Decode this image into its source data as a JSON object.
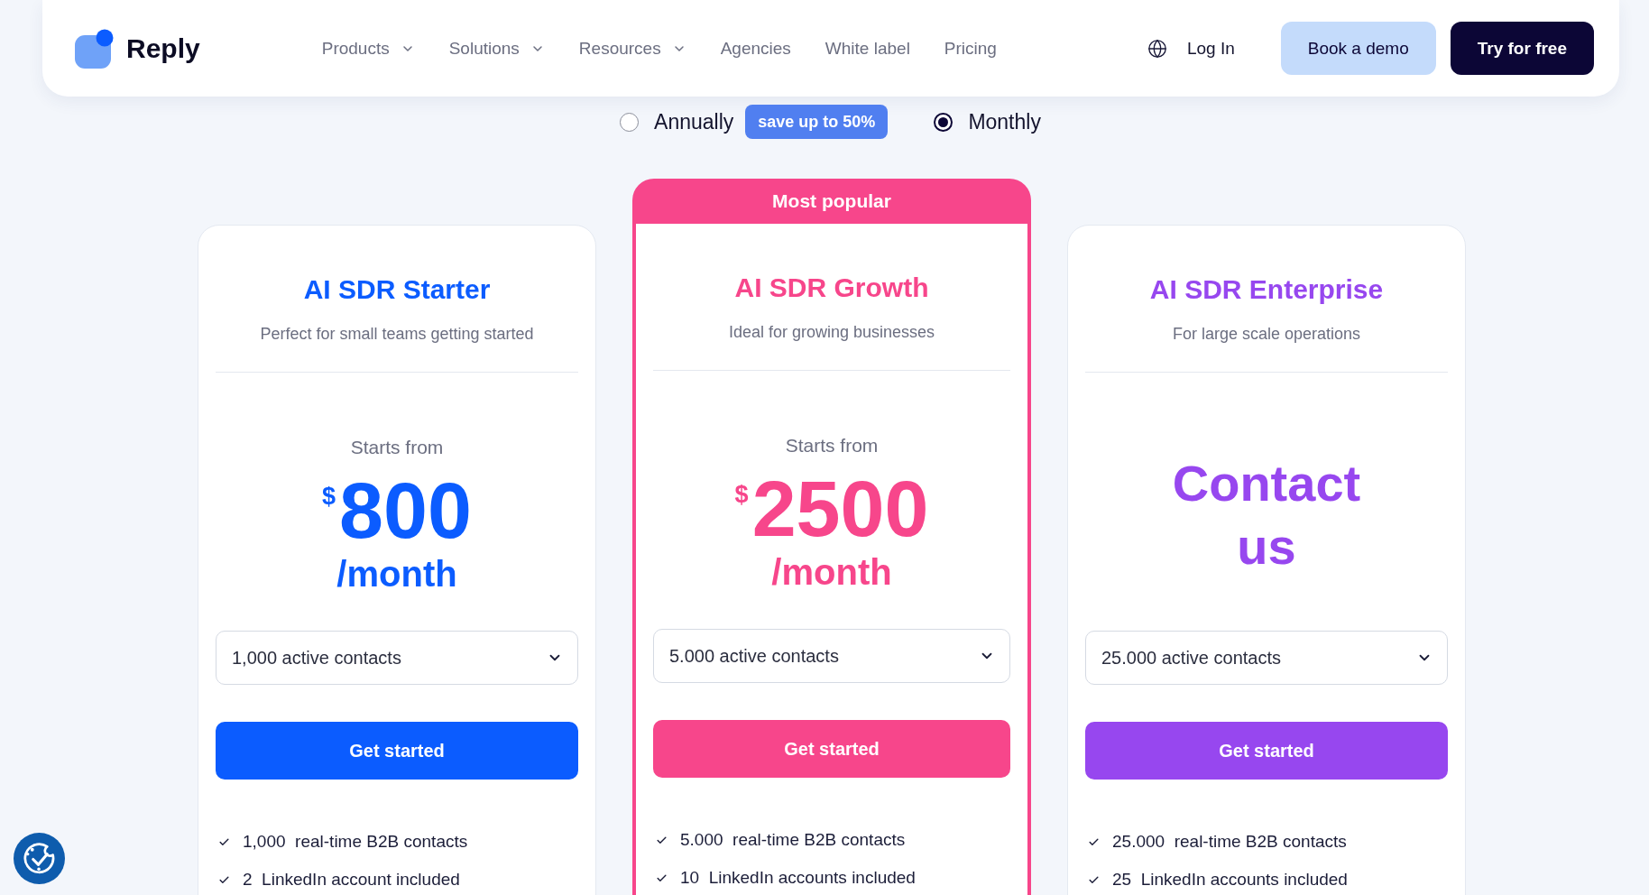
{
  "navbar": {
    "logo": {
      "text": "Reply"
    },
    "links": [
      {
        "label": "Products",
        "has_menu": true
      },
      {
        "label": "Solutions",
        "has_menu": true
      },
      {
        "label": "Resources",
        "has_menu": true
      },
      {
        "label": "Agencies",
        "has_menu": false
      },
      {
        "label": "White label",
        "has_menu": false
      },
      {
        "label": "Pricing",
        "has_menu": false
      }
    ],
    "login": "Log In",
    "buttons": [
      {
        "label": "Book a demo",
        "kind": "secondary"
      },
      {
        "label": "Try for free",
        "kind": "primary"
      }
    ]
  },
  "billing_toggle": {
    "options": [
      {
        "label": "Annually",
        "selected": false,
        "badge": "save up to 50%"
      },
      {
        "label": "Monthly",
        "selected": true
      }
    ]
  },
  "plans": [
    {
      "name": "AI SDR Starter",
      "tagline": "Perfect for small teams getting started",
      "color": "#0b5cff",
      "price": {
        "kind": "amount",
        "label": "Starts from",
        "currency": "$",
        "amount": "800",
        "period": "/month"
      },
      "contacts_select": {
        "value": "1,000 active contacts"
      },
      "cta": "Get started",
      "features": [
        "1,000  real-time B2B contacts",
        "2  LinkedIn account included"
      ]
    },
    {
      "name": "AI SDR Growth",
      "tagline": "Ideal for growing businesses",
      "color": "#f7468b",
      "badge": "Most popular",
      "price": {
        "kind": "amount",
        "label": "Starts from",
        "currency": "$",
        "amount": "2500",
        "period": "/month"
      },
      "contacts_select": {
        "value": "5.000 active contacts"
      },
      "cta": "Get started",
      "features": [
        "5.000  real-time B2B contacts",
        "10  LinkedIn accounts included"
      ]
    },
    {
      "name": "AI SDR Enterprise",
      "tagline": "For large scale operations",
      "color": "#9747ef",
      "price": {
        "kind": "contact",
        "text": "Contact us"
      },
      "contacts_select": {
        "value": "25.000 active contacts"
      },
      "cta": "Get started",
      "features": [
        "25.000  real-time B2B contacts",
        "25  LinkedIn accounts included"
      ]
    }
  ]
}
